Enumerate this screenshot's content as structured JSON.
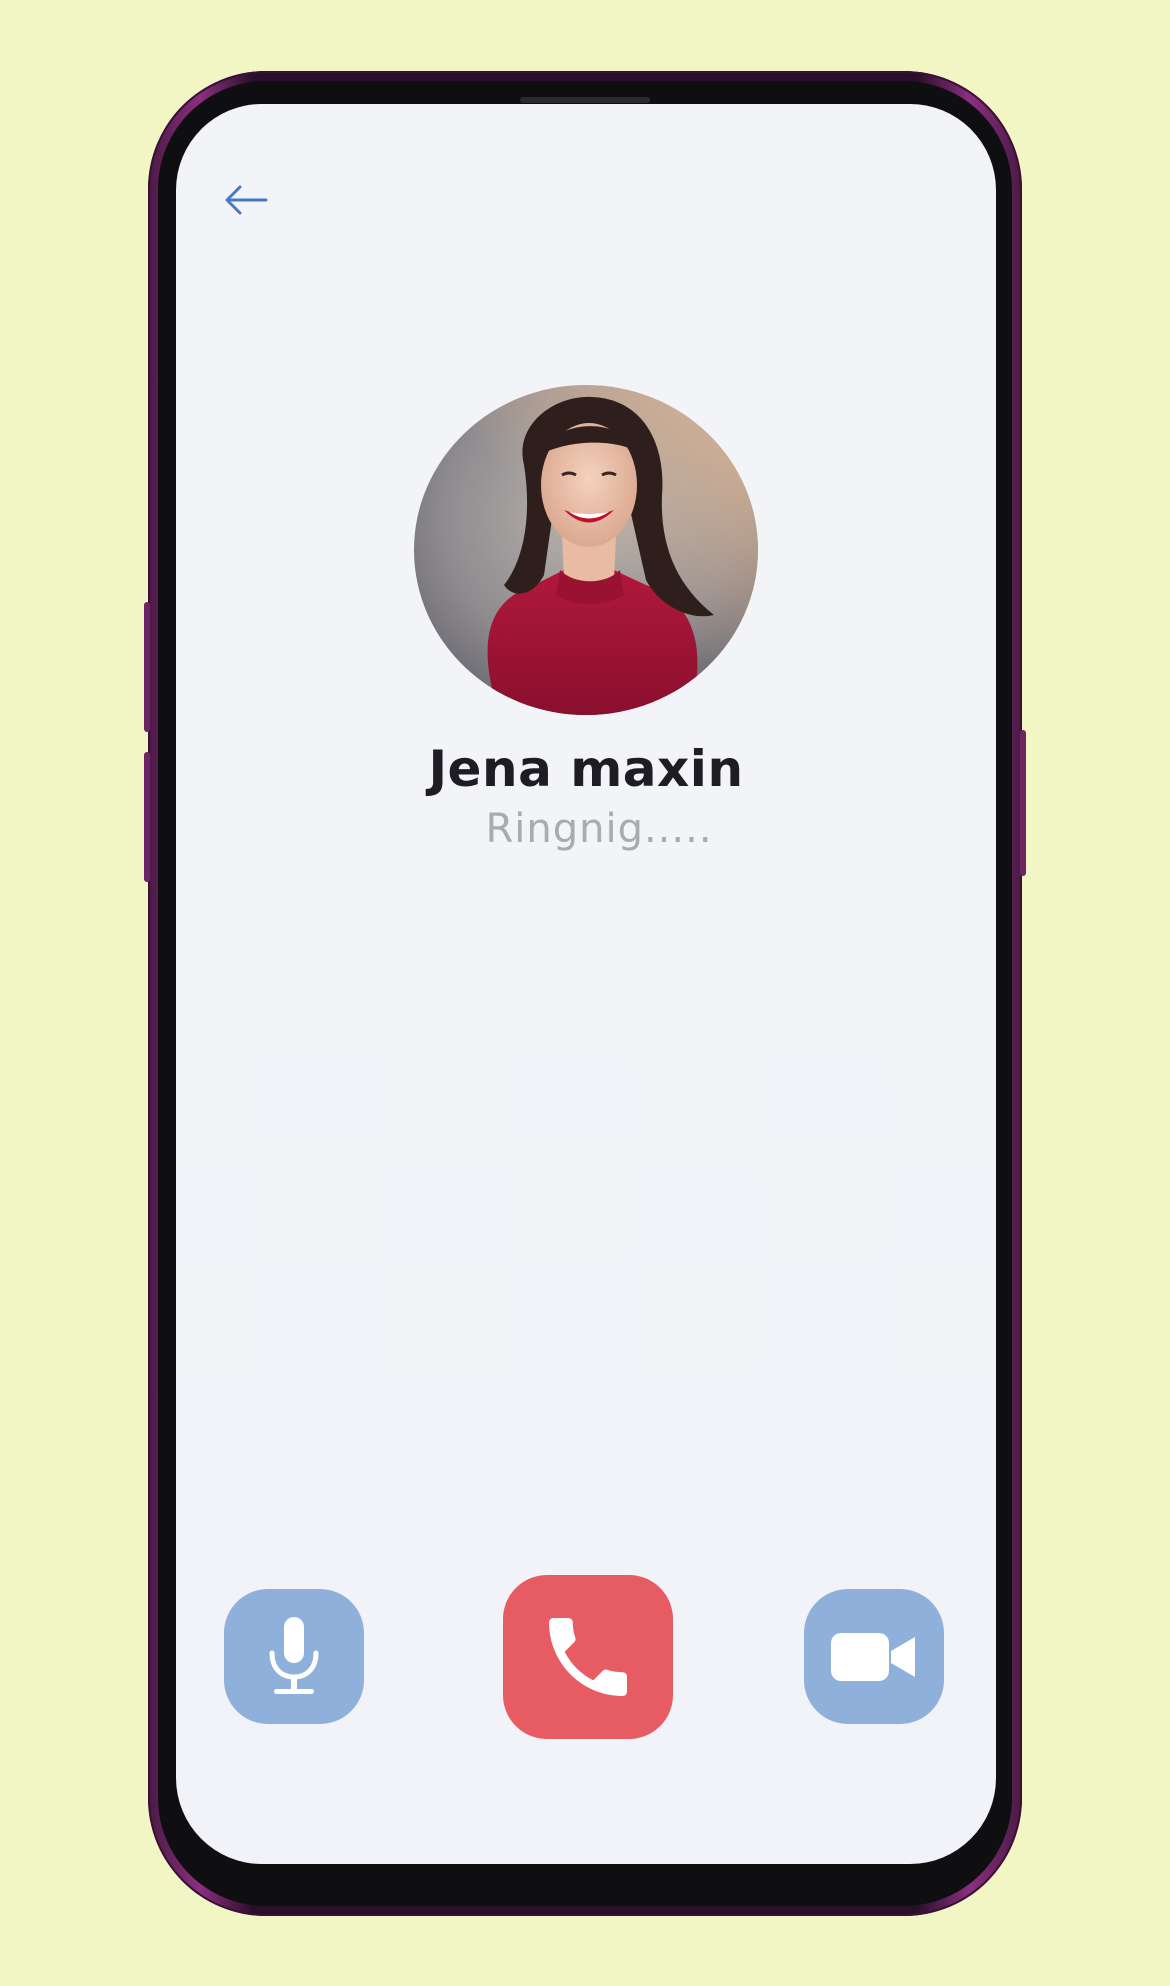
{
  "colors": {
    "page_background": "#f2f6c4",
    "screen_background": "#f3f4f8",
    "accent_blue": "#4a78c2",
    "name_text": "#1d1d23",
    "status_text": "#a9abb0",
    "mic_button": "#8fb0da",
    "end_call_button": "#e75b62",
    "video_button": "#8fb0da",
    "icon_white": "#ffffff"
  },
  "caller": {
    "name": "Jena maxin",
    "status": "Ringnig....."
  },
  "icons": {
    "back": "arrow-left-icon",
    "avatar": "caller-photo",
    "mic": "microphone-icon",
    "end_call": "phone-icon",
    "video": "video-camera-icon"
  }
}
